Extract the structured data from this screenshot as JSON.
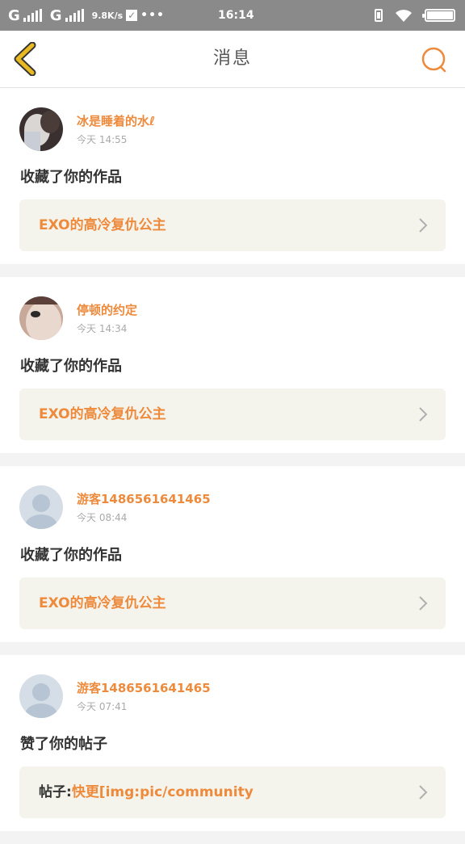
{
  "status_bar": {
    "carrier1": "G",
    "carrier2": "G",
    "speed": "9.8K/s",
    "dots": "•••",
    "time": "16:14"
  },
  "nav": {
    "title": "消息"
  },
  "messages": [
    {
      "user": "冰是睡着的水ℓ",
      "time": "今天  14:55",
      "action": "收藏了你的作品",
      "target_prefix": "",
      "target": "EXO的高冷复仇公主",
      "avatar": "photo-avatar-1"
    },
    {
      "user": "停顿的约定",
      "time": "今天  14:34",
      "action": "收藏了你的作品",
      "target_prefix": "",
      "target": "EXO的高冷复仇公主",
      "avatar": "photo-avatar-2"
    },
    {
      "user": "游客1486561641465",
      "time": "今天  08:44",
      "action": "收藏了你的作品",
      "target_prefix": "",
      "target": "EXO的高冷复仇公主",
      "avatar": "default-avatar"
    },
    {
      "user": "游客1486561641465",
      "time": "今天  07:41",
      "action": "赞了你的帖子",
      "target_prefix": "帖子:",
      "target": "快更[img:pic/community",
      "avatar": "default-avatar"
    }
  ],
  "colors": {
    "accent": "#ee8a3c",
    "back_arrow": "#e8b923",
    "status_bar": "#8a8a8a",
    "target_bg": "#f4f4ec"
  }
}
